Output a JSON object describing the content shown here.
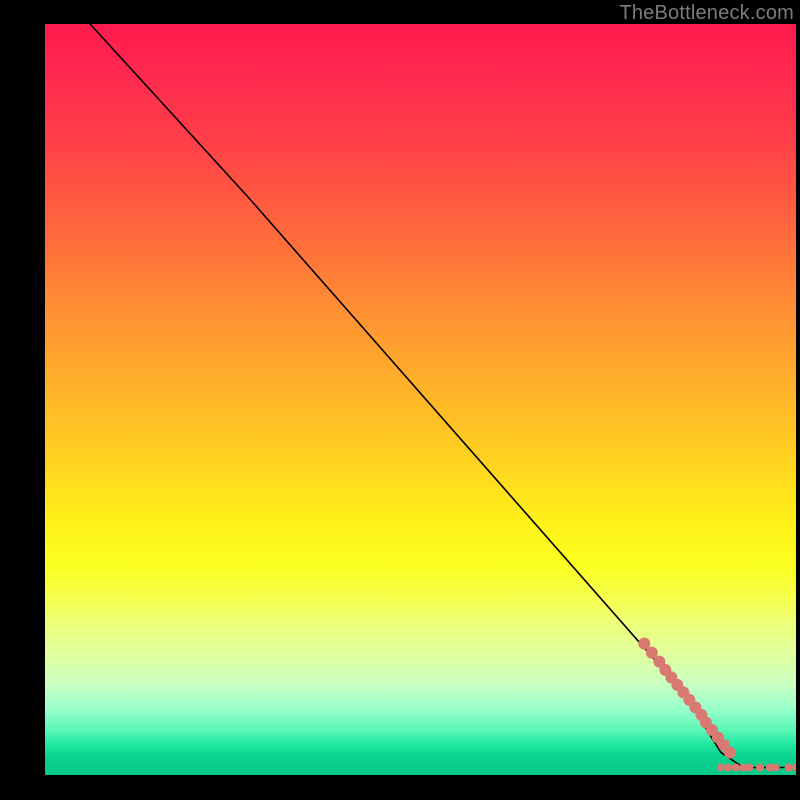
{
  "watermark": "TheBottleneck.com",
  "chart_data": {
    "type": "line",
    "title": "",
    "xlabel": "",
    "ylabel": "",
    "xlim": [
      0,
      100
    ],
    "ylim": [
      0,
      100
    ],
    "grid": false,
    "line": {
      "color": "#000000",
      "points": [
        {
          "x": 6,
          "y": 100
        },
        {
          "x": 27,
          "y": 77
        },
        {
          "x": 85,
          "y": 11
        },
        {
          "x": 90,
          "y": 3
        },
        {
          "x": 93,
          "y": 1
        },
        {
          "x": 100,
          "y": 1
        }
      ]
    },
    "scatter": {
      "color": "#d97a72",
      "radius": 5,
      "points_large": [
        {
          "x": 79.8,
          "y": 17.5
        },
        {
          "x": 80.8,
          "y": 16.3
        },
        {
          "x": 81.8,
          "y": 15.1
        },
        {
          "x": 82.6,
          "y": 14.0
        },
        {
          "x": 83.4,
          "y": 13.0
        },
        {
          "x": 84.2,
          "y": 12.0
        },
        {
          "x": 85.0,
          "y": 11.0
        },
        {
          "x": 85.8,
          "y": 10.0
        },
        {
          "x": 86.6,
          "y": 9.0
        },
        {
          "x": 87.4,
          "y": 8.0
        },
        {
          "x": 88.0,
          "y": 7.0
        },
        {
          "x": 88.8,
          "y": 6.0
        },
        {
          "x": 89.6,
          "y": 5.0
        },
        {
          "x": 90.4,
          "y": 4.0
        },
        {
          "x": 91.2,
          "y": 3.0
        }
      ],
      "points_small": [
        {
          "x": 90.0,
          "y": 1.0
        },
        {
          "x": 91.0,
          "y": 1.0
        },
        {
          "x": 92.0,
          "y": 1.0
        },
        {
          "x": 93.0,
          "y": 1.0
        },
        {
          "x": 93.8,
          "y": 1.0
        },
        {
          "x": 95.2,
          "y": 1.0
        },
        {
          "x": 96.5,
          "y": 1.0
        },
        {
          "x": 97.3,
          "y": 1.0
        },
        {
          "x": 99.0,
          "y": 1.0
        },
        {
          "x": 100.0,
          "y": 1.0
        }
      ]
    },
    "background_gradient": {
      "top": "#ff1a4d",
      "upper_mid": "#ffb02a",
      "mid": "#fff018",
      "lower_mid": "#c8ffc0",
      "bottom": "#08c889"
    }
  }
}
